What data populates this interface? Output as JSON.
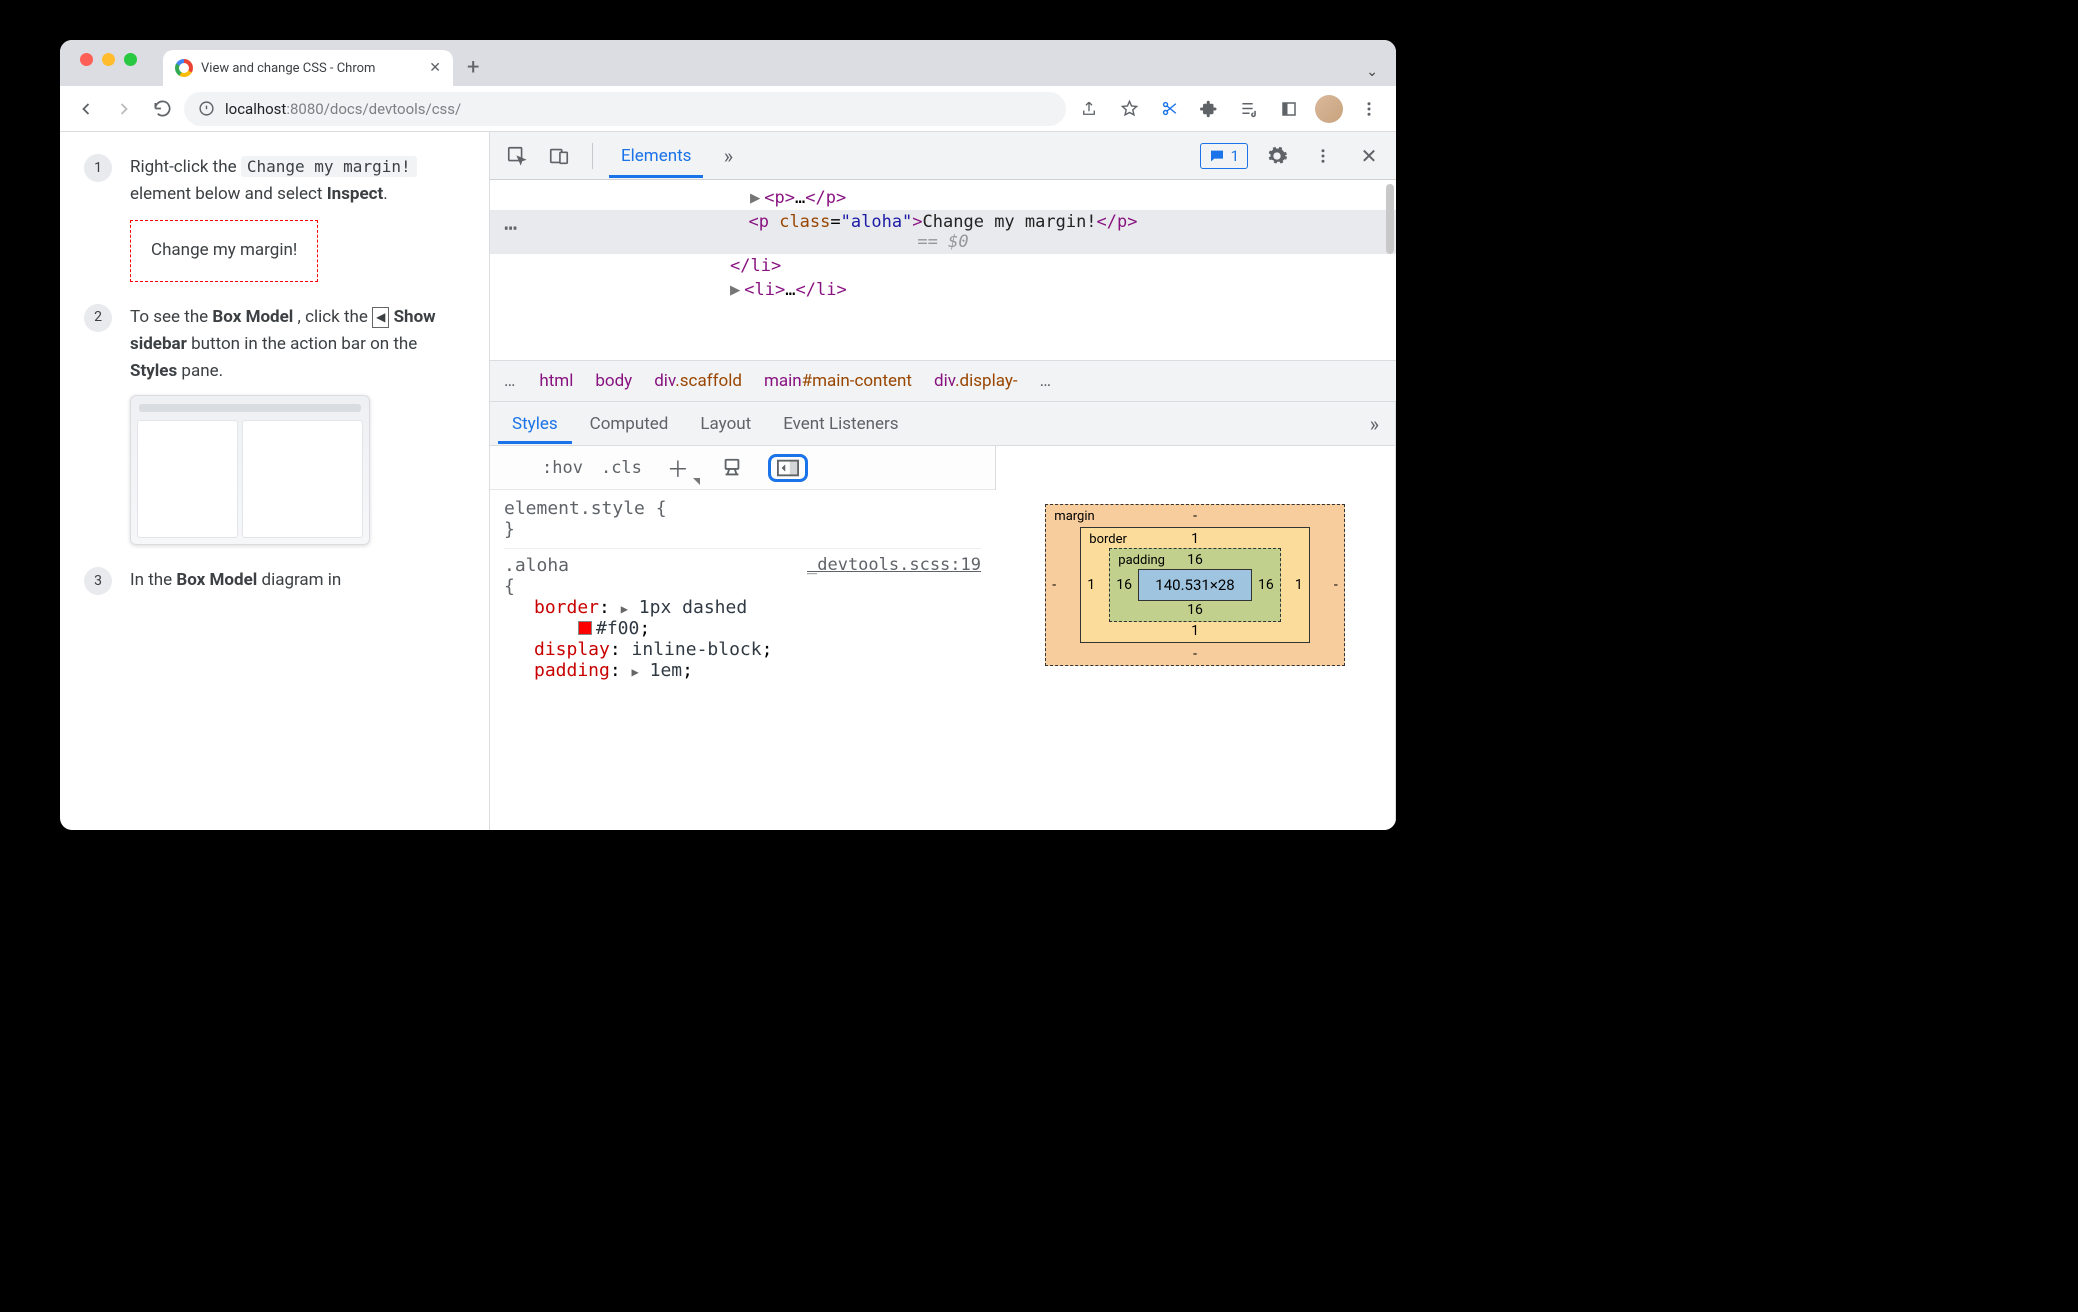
{
  "browser": {
    "tab_title": "View and change CSS - Chrom",
    "url_host": "localhost",
    "url_port": ":8080",
    "url_path": "/docs/devtools/css/"
  },
  "page": {
    "step1_pre": "Right-click the ",
    "step1_code": "Change my margin!",
    "step1_post": " element below and select ",
    "step1_bold": "Inspect",
    "dashed_text": "Change my margin!",
    "step2_a": "To see the ",
    "step2_bold1": "Box Model",
    "step2_b": ", click the ",
    "step2_icon_bold": "Show sidebar",
    "step2_c": " button in the action bar on the ",
    "step2_bold2": "Styles",
    "step2_d": " pane.",
    "step3_a": "In the ",
    "step3_bold": "Box Model",
    "step3_b": " diagram in"
  },
  "devtools": {
    "tabs": {
      "elements": "Elements"
    },
    "issues_count": "1",
    "dom": {
      "line1": "<p>…</p>",
      "sel_open": "<p class=\"aloha\">",
      "sel_text": "Change my margin!",
      "sel_close": "</p>",
      "eq0": "== $0",
      "line_close_li": "</li>",
      "line_li": "<li>…</li>"
    },
    "breadcrumbs": [
      "html",
      "body",
      "div.scaffold",
      "main#main-content",
      "div.display-"
    ],
    "subtabs": {
      "styles": "Styles",
      "computed": "Computed",
      "layout": "Layout",
      "listeners": "Event Listeners"
    },
    "toolbar": {
      "hov": ":hov",
      "cls": ".cls"
    },
    "rules": {
      "el_style": "element.style {",
      "el_close": "}",
      "aloha_sel": ".aloha",
      "aloha_src": "_devtools.scss:19",
      "brace_open": "{",
      "border_name": "border",
      "border_val": "1px dashed",
      "border_color": "#f00",
      "display_name": "display",
      "display_val": "inline-block",
      "padding_name": "padding",
      "padding_val": "1em"
    },
    "boxmodel": {
      "margin_label": "margin",
      "border_label": "border",
      "padding_label": "padding",
      "content": "140.531×28",
      "margin": {
        "top": "-",
        "right": "-",
        "bottom": "-",
        "left": "-"
      },
      "border": {
        "top": "1",
        "right": "1",
        "bottom": "1",
        "left": "1"
      },
      "padding": {
        "top": "16",
        "right": "16",
        "bottom": "16",
        "left": "16"
      }
    }
  }
}
